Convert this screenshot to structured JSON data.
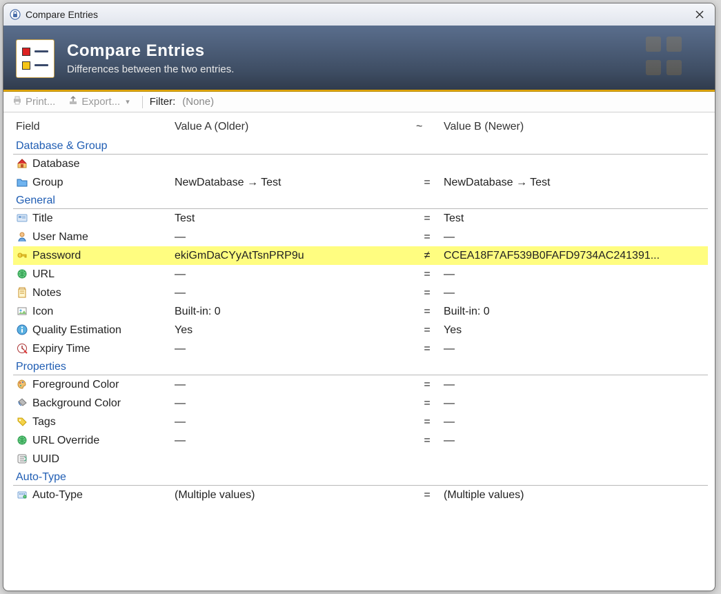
{
  "window": {
    "title": "Compare Entries"
  },
  "banner": {
    "title": "Compare Entries",
    "subtitle": "Differences between the two entries."
  },
  "toolbar": {
    "print": "Print...",
    "export": "Export...",
    "filter_label": "Filter:",
    "filter_value": "(None)"
  },
  "columns": {
    "field": "Field",
    "value_a": "Value A (Older)",
    "rel": "~",
    "value_b": "Value B (Newer)"
  },
  "sections": [
    {
      "title": "Database & Group",
      "rows": [
        {
          "icon": "home",
          "field": "Database",
          "a": "",
          "rel": "",
          "b": ""
        },
        {
          "icon": "folder",
          "field": "Group",
          "a": "NewDatabase → Test",
          "rel": "=",
          "b": "NewDatabase → Test"
        }
      ]
    },
    {
      "title": "General",
      "rows": [
        {
          "icon": "card",
          "field": "Title",
          "a": "Test",
          "rel": "=",
          "b": "Test"
        },
        {
          "icon": "user",
          "field": "User Name",
          "a": "—",
          "rel": "=",
          "b": "—"
        },
        {
          "icon": "key",
          "field": "Password",
          "a": "ekiGmDaCYyAtTsnPRP9u",
          "rel": "≠",
          "b": "CCEA18F7AF539B0FAFD9734AC241391...",
          "diff": true
        },
        {
          "icon": "globe",
          "field": "URL",
          "a": "—",
          "rel": "=",
          "b": "—"
        },
        {
          "icon": "notes",
          "field": "Notes",
          "a": "—",
          "rel": "=",
          "b": "—"
        },
        {
          "icon": "image",
          "field": "Icon",
          "a": "Built-in: 0",
          "rel": "=",
          "b": "Built-in: 0"
        },
        {
          "icon": "info",
          "field": "Quality Estimation",
          "a": "Yes",
          "rel": "=",
          "b": "Yes"
        },
        {
          "icon": "clock",
          "field": "Expiry Time",
          "a": "—",
          "rel": "=",
          "b": "—"
        }
      ]
    },
    {
      "title": "Properties",
      "rows": [
        {
          "icon": "palette",
          "field": "Foreground Color",
          "a": "—",
          "rel": "=",
          "b": "—"
        },
        {
          "icon": "bucket",
          "field": "Background Color",
          "a": "—",
          "rel": "=",
          "b": "—"
        },
        {
          "icon": "tag",
          "field": "Tags",
          "a": "—",
          "rel": "=",
          "b": "—"
        },
        {
          "icon": "globe",
          "field": "URL Override",
          "a": "—",
          "rel": "=",
          "b": "—"
        },
        {
          "icon": "uuid",
          "field": "UUID",
          "a": "",
          "rel": "",
          "b": ""
        }
      ]
    },
    {
      "title": "Auto-Type",
      "rows": [
        {
          "icon": "auto",
          "field": "Auto-Type",
          "a": "(Multiple values)",
          "rel": "=",
          "b": "(Multiple values)"
        }
      ]
    }
  ]
}
